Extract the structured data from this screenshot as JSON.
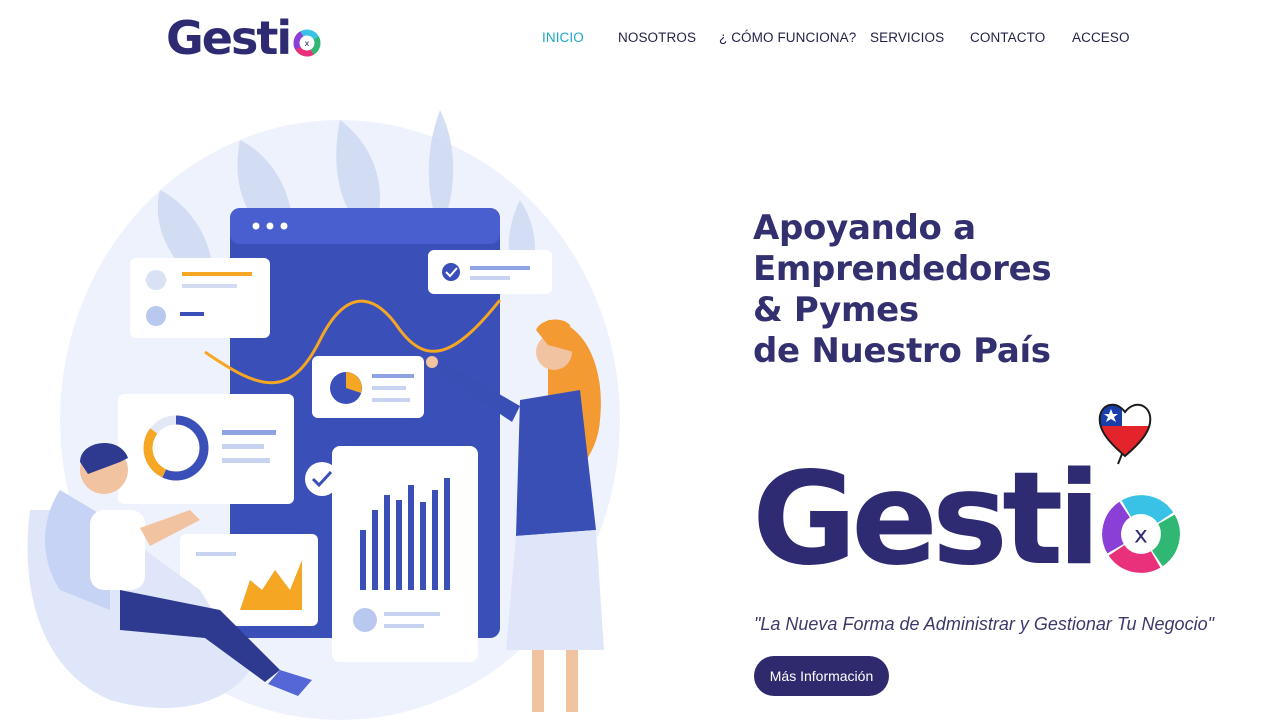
{
  "brand": {
    "name": "Gesti",
    "ring_letter": "x",
    "colors": {
      "navy": "#2e2b72",
      "ring_cyan": "#39c2e6",
      "ring_green": "#2fb773",
      "ring_pink": "#e8317a",
      "ring_purple": "#8a3fd6",
      "accent_teal": "#1aa7c9"
    }
  },
  "nav": {
    "items": [
      {
        "label": "INICIO",
        "active": true
      },
      {
        "label": "NOSOTROS",
        "active": false
      },
      {
        "label": "¿ CÓMO FUNCIONA?",
        "active": false
      },
      {
        "label": "SERVICIOS",
        "active": false
      },
      {
        "label": "CONTACTO",
        "active": false
      },
      {
        "label": "ACCESO",
        "active": false
      }
    ]
  },
  "hero": {
    "headline": [
      "Apoyando a",
      "Emprendedores",
      "& Pymes",
      "de Nuestro País"
    ],
    "tagline": "\"La Nueva Forma de Administrar y Gestionar Tu Negocio\"",
    "cta_label": "Más Información",
    "illustration": {
      "icon": "business-analytics-illustration",
      "colors": {
        "blue": "#3b4fb8",
        "orange": "#f5a623",
        "light": "#e9eefb"
      }
    },
    "badge": {
      "icon": "chile-flag-heart-icon"
    }
  }
}
